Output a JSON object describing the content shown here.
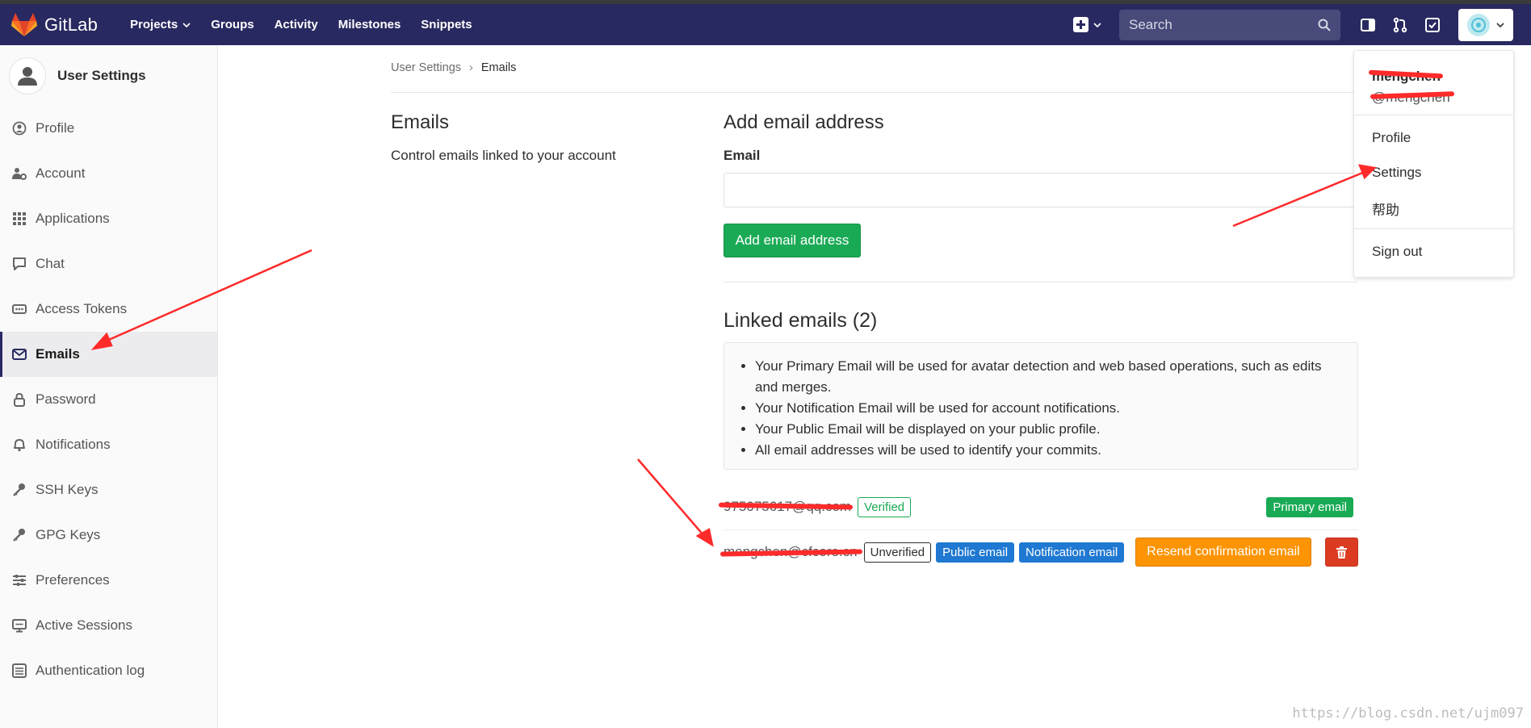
{
  "navbar": {
    "brand": "GitLab",
    "links": [
      "Projects",
      "Groups",
      "Activity",
      "Milestones",
      "Snippets"
    ],
    "search_placeholder": "Search",
    "icons": [
      "plus-icon",
      "search-icon",
      "panel-icon",
      "merge-request-icon",
      "todo-check-icon",
      "avatar-icon"
    ]
  },
  "sidebar": {
    "title": "User Settings",
    "items": [
      {
        "label": "Profile",
        "icon": "profile-icon"
      },
      {
        "label": "Account",
        "icon": "account-icon"
      },
      {
        "label": "Applications",
        "icon": "applications-icon"
      },
      {
        "label": "Chat",
        "icon": "chat-icon"
      },
      {
        "label": "Access Tokens",
        "icon": "token-icon"
      },
      {
        "label": "Emails",
        "icon": "mail-icon"
      },
      {
        "label": "Password",
        "icon": "lock-icon"
      },
      {
        "label": "Notifications",
        "icon": "bell-icon"
      },
      {
        "label": "SSH Keys",
        "icon": "key-icon"
      },
      {
        "label": "GPG Keys",
        "icon": "key-icon"
      },
      {
        "label": "Preferences",
        "icon": "sliders-icon"
      },
      {
        "label": "Active Sessions",
        "icon": "monitor-icon"
      },
      {
        "label": "Authentication log",
        "icon": "list-icon"
      }
    ],
    "active": "Emails"
  },
  "breadcrumb": {
    "parent": "User Settings",
    "separator": "›",
    "current": "Emails"
  },
  "section": {
    "title": "Emails",
    "description": "Control emails linked to your account"
  },
  "add_form": {
    "heading": "Add email address",
    "label": "Email",
    "value": "",
    "button": "Add email address"
  },
  "linked": {
    "heading": "Linked emails (2)",
    "info": [
      "Your Primary Email will be used for avatar detection and web based operations, such as edits and merges.",
      "Your Notification Email will be used for account notifications.",
      "Your Public Email will be displayed on your public profile.",
      "All email addresses will be used to identify your commits."
    ],
    "emails": [
      {
        "address": "975075617@qq.com",
        "badges": [
          "Verified"
        ],
        "right_badge": "Primary email"
      },
      {
        "address": "mengchen@cfcore.cn",
        "badges": [
          "Unverified",
          "Public email",
          "Notification email"
        ],
        "resend": "Resend confirmation email"
      }
    ]
  },
  "dropdown": {
    "name": "mengchen",
    "handle": "@mengchen",
    "items": [
      "Profile",
      "Settings",
      "帮助"
    ],
    "signout": "Sign out"
  },
  "watermark": "https://blog.csdn.net/ujm097",
  "colors": {
    "navbar": "#292961",
    "green": "#1aaa55",
    "blue": "#1f78d1",
    "orange": "#fc9403",
    "red": "#db3b21",
    "annotation": "#ff2a2a"
  }
}
